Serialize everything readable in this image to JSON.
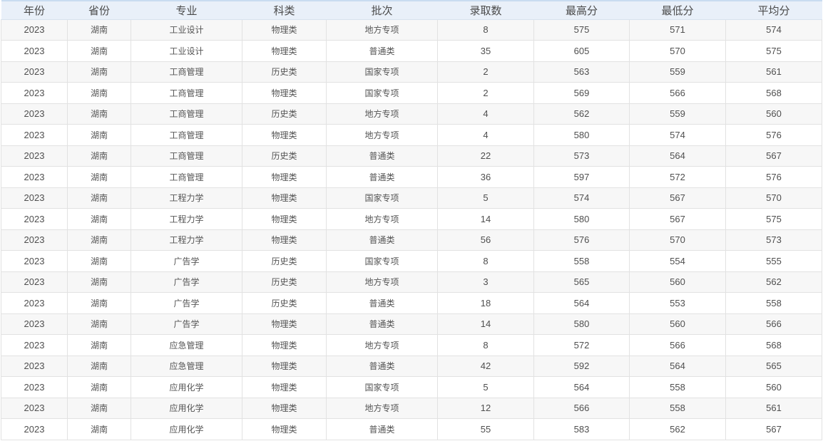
{
  "table": {
    "headers": [
      "年份",
      "省份",
      "专业",
      "科类",
      "批次",
      "录取数",
      "最高分",
      "最低分",
      "平均分"
    ],
    "rows": [
      [
        "2023",
        "湖南",
        "工业设计",
        "物理类",
        "地方专项",
        "8",
        "575",
        "571",
        "574"
      ],
      [
        "2023",
        "湖南",
        "工业设计",
        "物理类",
        "普通类",
        "35",
        "605",
        "570",
        "575"
      ],
      [
        "2023",
        "湖南",
        "工商管理",
        "历史类",
        "国家专项",
        "2",
        "563",
        "559",
        "561"
      ],
      [
        "2023",
        "湖南",
        "工商管理",
        "物理类",
        "国家专项",
        "2",
        "569",
        "566",
        "568"
      ],
      [
        "2023",
        "湖南",
        "工商管理",
        "历史类",
        "地方专项",
        "4",
        "562",
        "559",
        "560"
      ],
      [
        "2023",
        "湖南",
        "工商管理",
        "物理类",
        "地方专项",
        "4",
        "580",
        "574",
        "576"
      ],
      [
        "2023",
        "湖南",
        "工商管理",
        "历史类",
        "普通类",
        "22",
        "573",
        "564",
        "567"
      ],
      [
        "2023",
        "湖南",
        "工商管理",
        "物理类",
        "普通类",
        "36",
        "597",
        "572",
        "576"
      ],
      [
        "2023",
        "湖南",
        "工程力学",
        "物理类",
        "国家专项",
        "5",
        "574",
        "567",
        "570"
      ],
      [
        "2023",
        "湖南",
        "工程力学",
        "物理类",
        "地方专项",
        "14",
        "580",
        "567",
        "575"
      ],
      [
        "2023",
        "湖南",
        "工程力学",
        "物理类",
        "普通类",
        "56",
        "576",
        "570",
        "573"
      ],
      [
        "2023",
        "湖南",
        "广告学",
        "历史类",
        "国家专项",
        "8",
        "558",
        "554",
        "555"
      ],
      [
        "2023",
        "湖南",
        "广告学",
        "历史类",
        "地方专项",
        "3",
        "565",
        "560",
        "562"
      ],
      [
        "2023",
        "湖南",
        "广告学",
        "历史类",
        "普通类",
        "18",
        "564",
        "553",
        "558"
      ],
      [
        "2023",
        "湖南",
        "广告学",
        "物理类",
        "普通类",
        "14",
        "580",
        "560",
        "566"
      ],
      [
        "2023",
        "湖南",
        "应急管理",
        "物理类",
        "地方专项",
        "8",
        "572",
        "566",
        "568"
      ],
      [
        "2023",
        "湖南",
        "应急管理",
        "物理类",
        "普通类",
        "42",
        "592",
        "564",
        "565"
      ],
      [
        "2023",
        "湖南",
        "应用化学",
        "物理类",
        "国家专项",
        "5",
        "564",
        "558",
        "560"
      ],
      [
        "2023",
        "湖南",
        "应用化学",
        "物理类",
        "地方专项",
        "12",
        "566",
        "558",
        "561"
      ],
      [
        "2023",
        "湖南",
        "应用化学",
        "物理类",
        "普通类",
        "55",
        "583",
        "562",
        "567"
      ]
    ]
  },
  "colors": {
    "header_bg": "#e9f0f9",
    "header_border": "#c9dcf0",
    "row_odd": "#f7f7f7",
    "row_even": "#ffffff",
    "grid": "#e2e2e2"
  }
}
